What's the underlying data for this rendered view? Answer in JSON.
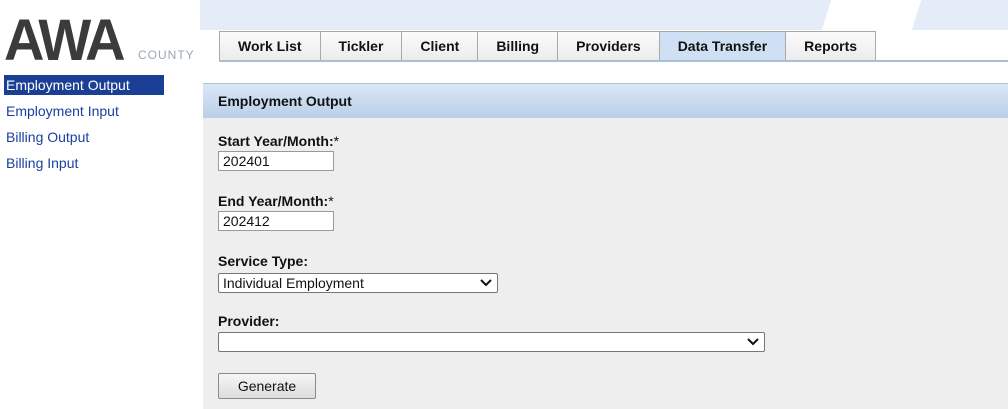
{
  "logo": {
    "main": "AWA",
    "sub": "COUNTY"
  },
  "tabs": [
    {
      "label": "Work List",
      "active": false
    },
    {
      "label": "Tickler",
      "active": false
    },
    {
      "label": "Client",
      "active": false
    },
    {
      "label": "Billing",
      "active": false
    },
    {
      "label": "Providers",
      "active": false
    },
    {
      "label": "Data Transfer",
      "active": true
    },
    {
      "label": "Reports",
      "active": false
    }
  ],
  "sidebar": {
    "items": [
      {
        "label": "Employment Output",
        "active": true
      },
      {
        "label": "Employment Input",
        "active": false
      },
      {
        "label": "Billing Output",
        "active": false
      },
      {
        "label": "Billing Input",
        "active": false
      }
    ]
  },
  "panel": {
    "title": "Employment Output",
    "start": {
      "label": "Start Year/Month:",
      "required_mark": "*",
      "value": "202401"
    },
    "end": {
      "label": "End Year/Month:",
      "required_mark": "*",
      "value": "202412"
    },
    "service_type": {
      "label": "Service Type:",
      "selected": "Individual Employment"
    },
    "provider": {
      "label": "Provider:",
      "selected": ""
    },
    "generate_label": "Generate"
  },
  "colors": {
    "accent": "#1c3f96",
    "link": "#1a3fa0",
    "header_band": "#b9cfe9",
    "panel_bg": "#eeeeee",
    "active_tab": "#cfe0f4"
  },
  "icons": {
    "select_arrow": "chevron-down-icon"
  }
}
